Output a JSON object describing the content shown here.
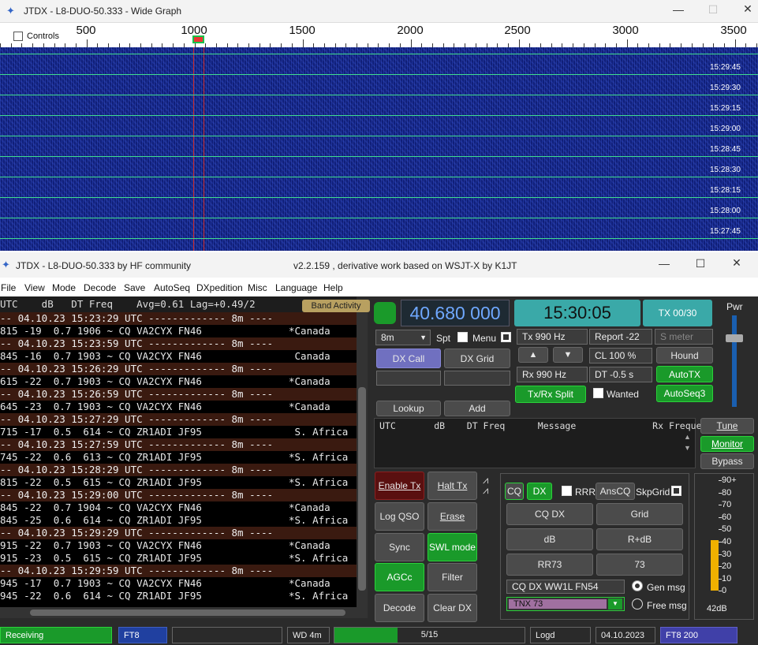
{
  "wide_graph": {
    "title": "JTDX - L8-DUO-50.333 - Wide Graph",
    "controls_label": "Controls",
    "ruler_labels": [
      "500",
      "1000",
      "1500",
      "2000",
      "2500",
      "3000",
      "3500"
    ],
    "time_labels": [
      "15:29:45",
      "15:29:30",
      "15:29:15",
      "15:29:00",
      "15:28:45",
      "15:28:30",
      "15:28:15",
      "15:28:00",
      "15:27:45"
    ],
    "right_edge_glyph": "8"
  },
  "main_window": {
    "title": "JTDX - L8-DUO-50.333   by HF community",
    "subtitle": "v2.2.159 , derivative work based on WSJT-X by K1JT",
    "menu": [
      "File",
      "View",
      "Mode",
      "Decode",
      "Save",
      "AutoSeq",
      "DXpedition",
      "Misc",
      "Language",
      "Help"
    ]
  },
  "decode_panel": {
    "header": "UTC    dB   DT Freq    Avg=0.61 Lag=+0.49/2",
    "band_activity_label": "Band Activity",
    "rows": [
      {
        "sep": true,
        "text": "-- 04.10.23 15:23:29 UTC ------------- 8m ----"
      },
      {
        "sep": false,
        "text": "815 -19  0.7 1906 ~ CQ VA2CYX FN46",
        "country": "*Canada"
      },
      {
        "sep": true,
        "text": "-- 04.10.23 15:23:59 UTC ------------- 8m ----"
      },
      {
        "sep": false,
        "text": "845 -16  0.7 1903 ~ CQ VA2CYX FN46",
        "country": " Canada"
      },
      {
        "sep": true,
        "text": "-- 04.10.23 15:26:29 UTC ------------- 8m ----"
      },
      {
        "sep": false,
        "text": "615 -22  0.7 1903 ~ CQ VA2CYX FN46",
        "country": "*Canada"
      },
      {
        "sep": true,
        "text": "-- 04.10.23 15:26:59 UTC ------------- 8m ----"
      },
      {
        "sep": false,
        "text": "645 -23  0.7 1903 ~ CQ VA2CYX FN46",
        "country": "*Canada"
      },
      {
        "sep": true,
        "text": "-- 04.10.23 15:27:29 UTC ------------- 8m ----"
      },
      {
        "sep": false,
        "text": "715 -17  0.5  614 ~ CQ ZR1ADI JF95",
        "country": " S. Africa"
      },
      {
        "sep": true,
        "text": "-- 04.10.23 15:27:59 UTC ------------- 8m ----"
      },
      {
        "sep": false,
        "text": "745 -22  0.6  613 ~ CQ ZR1ADI JF95",
        "country": "*S. Africa"
      },
      {
        "sep": true,
        "text": "-- 04.10.23 15:28:29 UTC ------------- 8m ----"
      },
      {
        "sep": false,
        "text": "815 -22  0.5  615 ~ CQ ZR1ADI JF95",
        "country": "*S. Africa"
      },
      {
        "sep": true,
        "text": "-- 04.10.23 15:29:00 UTC ------------- 8m ----"
      },
      {
        "sep": false,
        "text": "845 -22  0.7 1904 ~ CQ VA2CYX FN46",
        "country": "*Canada"
      },
      {
        "sep": false,
        "text": "845 -25  0.6  614 ~ CQ ZR1ADI JF95",
        "country": "*S. Africa"
      },
      {
        "sep": true,
        "text": "-- 04.10.23 15:29:29 UTC ------------- 8m ----"
      },
      {
        "sep": false,
        "text": "915 -22  0.7 1903 ~ CQ VA2CYX FN46",
        "country": "*Canada"
      },
      {
        "sep": false,
        "text": "915 -23  0.5  615 ~ CQ ZR1ADI JF95",
        "country": "*S. Africa"
      },
      {
        "sep": true,
        "text": "-- 04.10.23 15:29:59 UTC ------------- 8m ----"
      },
      {
        "sep": false,
        "text": "945 -17  0.7 1903 ~ CQ VA2CYX FN46",
        "country": "*Canada"
      },
      {
        "sep": false,
        "text": "945 -22  0.6  614 ~ CQ ZR1ADI JF95",
        "country": "*S. Africa"
      }
    ]
  },
  "controls": {
    "frequency": "40.680 000",
    "clock": "15:30:05",
    "tx_counter": "TX 00/30",
    "pwr_label": "Pwr",
    "band": "8m",
    "spt_label": "Spt",
    "menu_label": "Menu",
    "tx_hz": "Tx  990  Hz",
    "rx_hz": "Rx  990  Hz",
    "report": "Report -22",
    "smeter_placeholder": "S meter",
    "cl": "CL  100 %",
    "dt": "DT -0.5 s",
    "dx_call": "DX Call",
    "dx_grid": "DX Grid",
    "hound": "Hound",
    "autotx": "AutoTX",
    "txrx_split": "Tx/Rx Split",
    "wanted": "Wanted",
    "autoseq3": "AutoSeq3",
    "lookup": "Lookup",
    "add": "Add",
    "rx_header": "UTC       dB    DT Freq      Message              Rx Frequency",
    "tune": "Tune",
    "monitor": "Monitor",
    "bypass": "Bypass",
    "enable_tx": "Enable Tx",
    "halt_tx": "Halt Tx",
    "log_qso": "Log QSO",
    "erase": "Erase",
    "sync": "Sync",
    "swl_mode": "SWL mode",
    "agcc": "AGCc",
    "filter": "Filter",
    "decode": "Decode",
    "clear_dx": "Clear DX",
    "cq": "CQ",
    "dx": "DX",
    "rrr": "RRR",
    "anscq": "AnsCQ",
    "skpgrid": "SkpGrid",
    "cq_dx": "CQ DX",
    "grid": "Grid",
    "db": "dB",
    "r_db": "R+dB",
    "rr73": "RR73",
    "n73": "73",
    "gen_msg_text": "CQ DX WW1L FN54",
    "gen_msg_label": "Gen msg",
    "tnx": "TNX 73",
    "free_msg_label": "Free msg",
    "meter_ticks": [
      "90+",
      "80",
      "70",
      "60",
      "50",
      "40",
      "30",
      "20",
      "10",
      "0"
    ],
    "meter_readout": "42dB",
    "meter_level": 0.46
  },
  "statusbar": {
    "receiving": "Receiving",
    "mode": "FT8",
    "wd": "WD 4m",
    "progress": "5/15",
    "progress_fraction": 0.333,
    "logd": "Logd",
    "date": "04.10.2023",
    "mode_rate": "FT8  200"
  },
  "colors": {
    "accent_green": "#1a9a2a",
    "freq_text": "#6fa8ff",
    "clock_bg": "#3aa9a8"
  }
}
